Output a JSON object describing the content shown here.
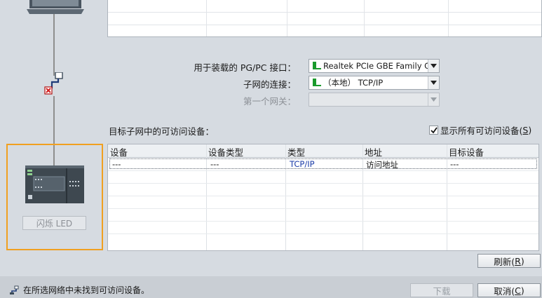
{
  "form": {
    "pgpc_label": "用于装载的 PG/PC 接口：",
    "pgpc_value": "Realtek PCIe GBE Family Con",
    "subnet_label": "子网的连接：",
    "subnet_value": "（本地）  TCP/IP",
    "gateway_label": "第一个网关：",
    "gateway_value": ""
  },
  "devices": {
    "title": "目标子网中的可访问设备：",
    "show_all_label": "显示所有可访问设备(",
    "show_all_key": "S",
    "show_all_end": ")",
    "show_all_checked": true,
    "columns": [
      "设备",
      "设备类型",
      "类型",
      "地址",
      "目标设备"
    ],
    "rows": [
      [
        "---",
        "---",
        "TCP/IP",
        "访问地址",
        "---"
      ]
    ]
  },
  "led_button": "闪烁 LED",
  "buttons": {
    "refresh": "刷新(",
    "refresh_key": "R",
    "refresh_end": ")",
    "download": "下载",
    "cancel": "取消(",
    "cancel_key": "C",
    "cancel_end": ")"
  },
  "status": {
    "message": "在所选网络中未找到可访问设备。"
  },
  "colors": {
    "accent_orange": "#f0a020",
    "nic_green": "#1a9a2c",
    "error_red": "#d42020",
    "link_blue": "#1b3ca8"
  },
  "icons": {
    "network_card": "nic-icon",
    "connection_error": "connection-error-icon",
    "status_network": "network-status-icon"
  }
}
